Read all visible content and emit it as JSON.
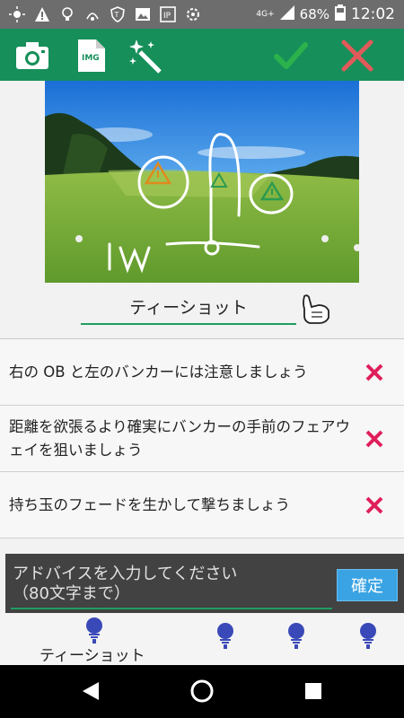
{
  "status_bar": {
    "network": "4G+",
    "battery": "68%",
    "time": "12:02"
  },
  "toolbar": {
    "camera_icon": "camera-icon",
    "img_icon_label": "IMG",
    "magic_icon": "magic-wand-icon",
    "confirm_icon": "check-icon",
    "cancel_icon": "close-icon",
    "colors": {
      "background": "#168f5a",
      "check": "#2bb24c",
      "close": "#e05a5a"
    }
  },
  "photo": {
    "annotation_text": "IW"
  },
  "shot": {
    "label": "ティーショット"
  },
  "advice": [
    {
      "text": "右の OB と左のバンカーには注意しましょう"
    },
    {
      "text": "距離を欲張るより確実にバンカーの手前のフェアウェイを狙いましょう"
    },
    {
      "text": "持ち玉のフェードを生かして撃ちましょう"
    }
  ],
  "input": {
    "placeholder_line1": "アドバイスを入力してください",
    "placeholder_line2": "（80文字まで）",
    "confirm_label": "確定"
  },
  "tabs": {
    "active_label": "ティーショット",
    "tee_icon": "golf-tee-icon",
    "tee_color": "#3a49b8"
  }
}
